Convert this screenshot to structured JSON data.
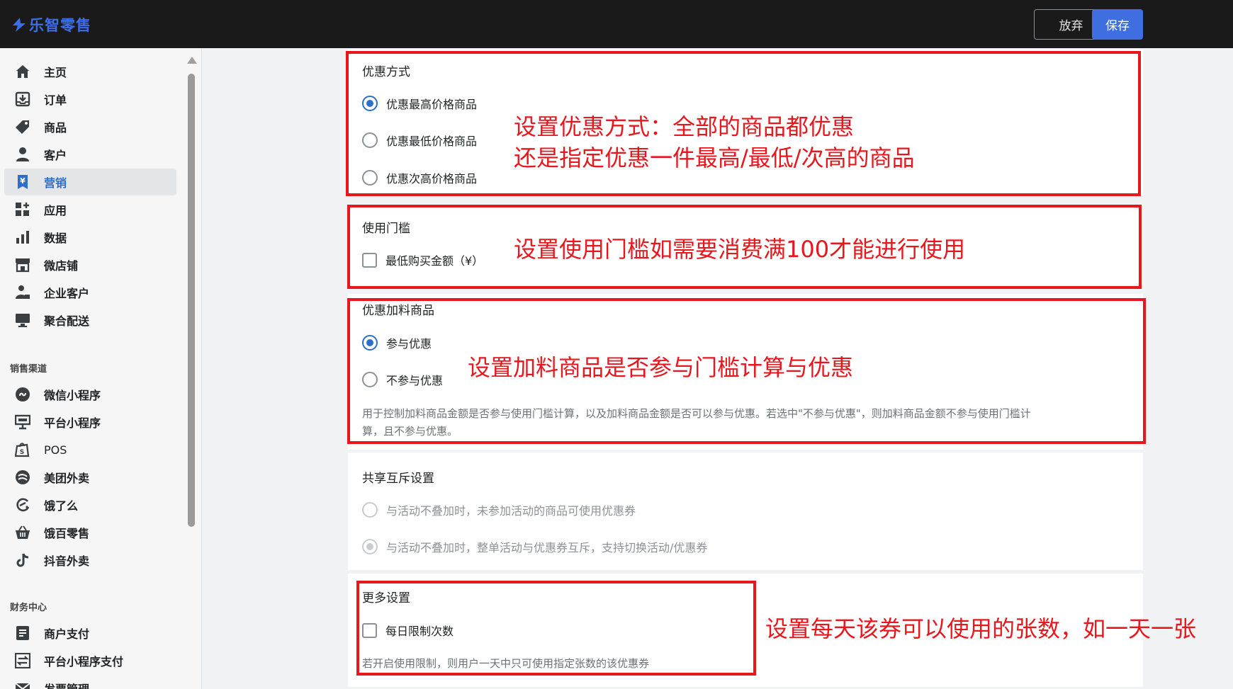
{
  "app": {
    "logo_text": "乐智零售"
  },
  "toolbar": {
    "discard_label": "放弃",
    "save_label": "保存"
  },
  "sidebar": {
    "main_items": [
      {
        "label": "主页",
        "icon": "home-icon"
      },
      {
        "label": "订单",
        "icon": "order-inbox-icon"
      },
      {
        "label": "商品",
        "icon": "tag-icon"
      },
      {
        "label": "客户",
        "icon": "person-icon"
      },
      {
        "label": "营销",
        "icon": "marketing-icon",
        "active": true
      },
      {
        "label": "应用",
        "icon": "apps-icon"
      },
      {
        "label": "数据",
        "icon": "bar-chart-icon"
      },
      {
        "label": "微店铺",
        "icon": "store-icon"
      },
      {
        "label": "企业客户",
        "icon": "business-person-icon"
      },
      {
        "label": "聚合配送",
        "icon": "monitor-icon"
      }
    ],
    "sales_channels_label": "销售渠道",
    "channel_items": [
      {
        "label": "微信小程序",
        "icon": "mini-program-icon"
      },
      {
        "label": "平台小程序",
        "icon": "platform-icon"
      },
      {
        "label": "POS",
        "icon": "shopping-bag-icon"
      },
      {
        "label": "美团外卖",
        "icon": "meituan-icon"
      },
      {
        "label": "饿了么",
        "icon": "eleme-icon"
      },
      {
        "label": "饿百零售",
        "icon": "basket-icon"
      },
      {
        "label": "抖音外卖",
        "icon": "tiktok-icon"
      }
    ],
    "finance_label": "财务中心",
    "finance_items": [
      {
        "label": "商户支付",
        "icon": "document-icon"
      },
      {
        "label": "平台小程序支付",
        "icon": "transfer-icon"
      },
      {
        "label": "发票管理",
        "icon": "mail-icon"
      }
    ]
  },
  "discount_method": {
    "title": "优惠方式",
    "options": [
      {
        "label": "优惠最高价格商品",
        "selected": true
      },
      {
        "label": "优惠最低价格商品",
        "selected": false
      },
      {
        "label": "优惠次高价格商品",
        "selected": false
      }
    ]
  },
  "threshold": {
    "title": "使用门槛",
    "min_amount_label": "最低购买金额（¥）",
    "checked": false
  },
  "addon_items": {
    "title": "优惠加料商品",
    "options": [
      {
        "label": "参与优惠",
        "selected": true
      },
      {
        "label": "不参与优惠",
        "selected": false
      }
    ],
    "help_line1": "用于控制加料商品金额是否参与使用门槛计算，以及加料商品金额是否可以参与优惠。若选中\"不参与优惠\"，则加料商品金额不参与使用门槛计",
    "help_line2": "算，且不参与优惠。"
  },
  "sharing": {
    "title": "共享互斥设置",
    "options": [
      {
        "label": "与活动不叠加时，未参加活动的商品可使用优惠券",
        "selected": false,
        "disabled": true
      },
      {
        "label": "与活动不叠加时，整单活动与优惠券互斥，支持切换活动/优惠券",
        "selected": true,
        "disabled": true
      }
    ]
  },
  "more_settings": {
    "title": "更多设置",
    "daily_limit_label": "每日限制次数",
    "checked": false,
    "help": "若开启使用限制，则用户一天中只可使用指定张数的该优惠券"
  },
  "annotations": {
    "discount_method_line1": "设置优惠方式：全部的商品都优惠",
    "discount_method_line2": "还是指定优惠一件最高/最低/次高的商品",
    "threshold": "设置使用门槛如需要消费满100才能进行使用",
    "addon": "设置加料商品是否参与门槛计算与优惠",
    "daily_limit": "设置每天该券可以使用的张数，如一天一张"
  },
  "colors": {
    "accent": "#2c6ecb",
    "save_button": "#3f6ee0",
    "annotation_red": "#e8171d",
    "topbar": "#1a1a1a"
  }
}
